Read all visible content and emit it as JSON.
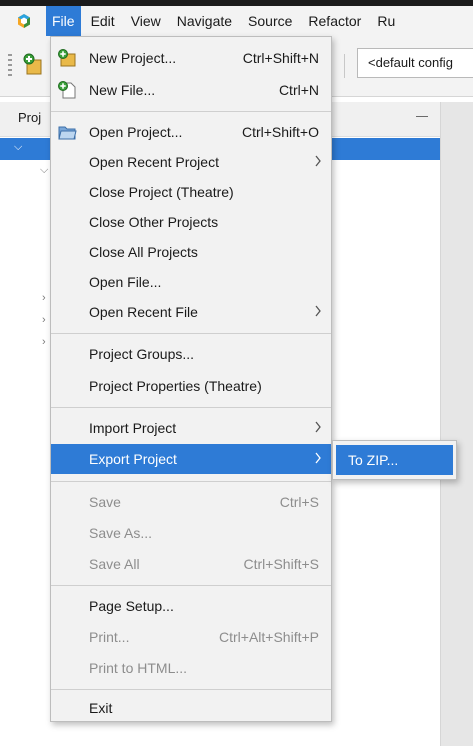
{
  "menubar": {
    "items": [
      "File",
      "Edit",
      "View",
      "Navigate",
      "Source",
      "Refactor",
      "Ru"
    ]
  },
  "toolbar": {
    "config_value": "<default config"
  },
  "projects_pane": {
    "title": "Proj"
  },
  "file_menu": {
    "items": [
      {
        "label": "New Project...",
        "shortcut": "Ctrl+Shift+N",
        "icon": "new-project-icon"
      },
      {
        "label": "New File...",
        "shortcut": "Ctrl+N",
        "icon": "new-file-icon"
      },
      {
        "label": "Open Project...",
        "shortcut": "Ctrl+Shift+O",
        "icon": "open-project-icon"
      },
      {
        "label": "Open Recent Project",
        "shortcut": ""
      },
      {
        "label": "Close Project (Theatre)",
        "shortcut": ""
      },
      {
        "label": "Close Other Projects",
        "shortcut": ""
      },
      {
        "label": "Close All Projects",
        "shortcut": ""
      },
      {
        "label": "Open File...",
        "shortcut": ""
      },
      {
        "label": "Open Recent File",
        "shortcut": ""
      },
      {
        "label": "Project Groups...",
        "shortcut": ""
      },
      {
        "label": "Project Properties (Theatre)",
        "shortcut": ""
      },
      {
        "label": "Import Project",
        "shortcut": ""
      },
      {
        "label": "Export Project",
        "shortcut": ""
      },
      {
        "label": "Save",
        "shortcut": "Ctrl+S"
      },
      {
        "label": "Save As...",
        "shortcut": ""
      },
      {
        "label": "Save All",
        "shortcut": "Ctrl+Shift+S"
      },
      {
        "label": "Page Setup...",
        "shortcut": ""
      },
      {
        "label": "Print...",
        "shortcut": "Ctrl+Alt+Shift+P"
      },
      {
        "label": "Print to HTML...",
        "shortcut": ""
      },
      {
        "label": "Exit",
        "shortcut": ""
      }
    ]
  },
  "export_submenu": {
    "items": [
      {
        "label": "To ZIP..."
      }
    ]
  },
  "colors": {
    "highlight": "#2e7bd6",
    "menu_bg": "#f2f2f2",
    "disabled_text": "#8d8d8d"
  }
}
